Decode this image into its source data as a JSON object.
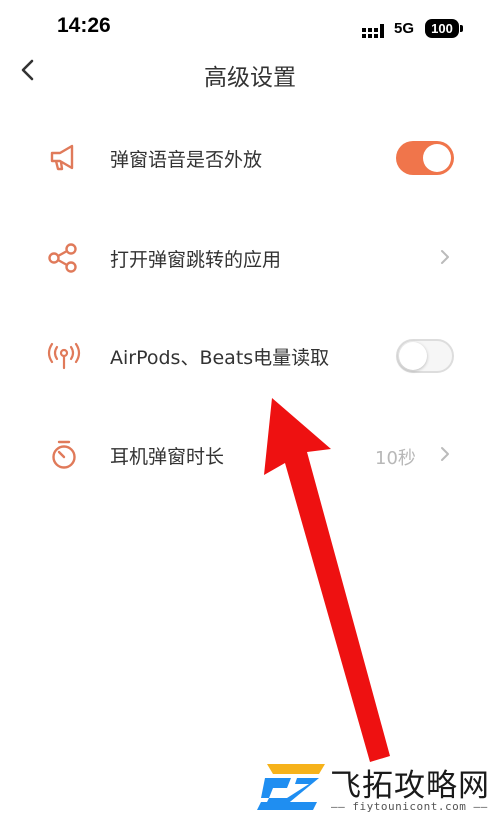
{
  "status_bar": {
    "time": "14:26",
    "network": "5G",
    "battery": "100"
  },
  "header": {
    "title": "高级设置"
  },
  "settings": [
    {
      "label": "弹窗语音是否外放",
      "icon": "megaphone-icon",
      "control": "toggle",
      "on": true
    },
    {
      "label": "打开弹窗跳转的应用",
      "icon": "share-icon",
      "control": "chevron"
    },
    {
      "label": "AirPods、Beats电量读取",
      "icon": "broadcast-icon",
      "control": "toggle",
      "on": false
    },
    {
      "label": "耳机弹窗时长",
      "icon": "timer-icon",
      "control": "chevron",
      "value": "10秒"
    }
  ],
  "watermark": {
    "name": "飞拓攻略网",
    "url": "—— fiytounicont.com ——"
  },
  "colors": {
    "accent": "#f0754b",
    "icon": "#e07a5a",
    "annotation_arrow": "#ee1111"
  }
}
